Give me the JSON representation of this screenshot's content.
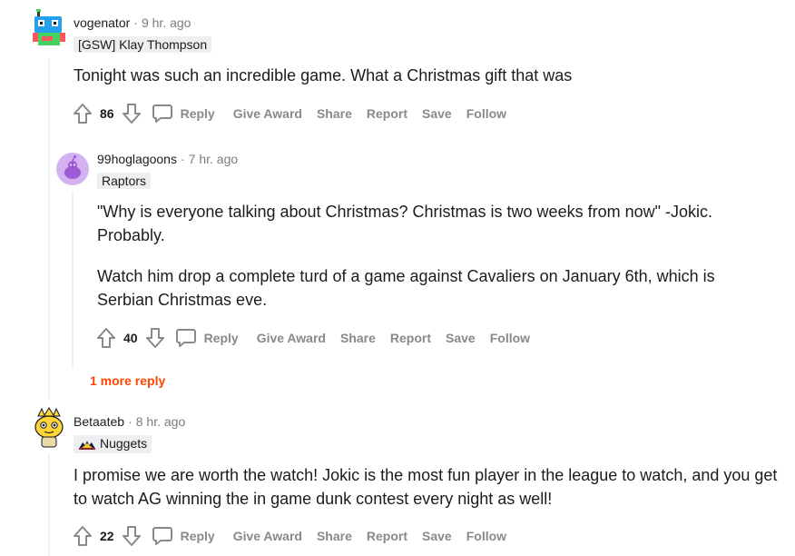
{
  "comments": [
    {
      "username": "vogenator",
      "time": "9 hr. ago",
      "flair": "[GSW] Klay Thompson",
      "body": [
        "Tonight was such an incredible game. What a Christmas gift that was"
      ],
      "score": "86"
    },
    {
      "username": "99hoglagoons",
      "time": "7 hr. ago",
      "flair": "Raptors",
      "body": [
        "\"Why is everyone talking about Christmas? Christmas is two weeks from now\" -Jokic. Probably.",
        "Watch him drop a complete turd of a game against Cavaliers on January 6th, which is Serbian Christmas eve."
      ],
      "score": "40"
    },
    {
      "username": "Betaateb",
      "time": "8 hr. ago",
      "flair": "Nuggets",
      "body": [
        "I promise we are worth the watch! Jokic is the most fun player in the league to watch, and you get to watch AG winning the in game dunk contest every night as well!"
      ],
      "score": "22"
    }
  ],
  "actions": {
    "reply": "Reply",
    "give_award": "Give Award",
    "share": "Share",
    "report": "Report",
    "save": "Save",
    "follow": "Follow"
  },
  "more_replies": "1 more reply",
  "separator": "·",
  "icons": {
    "upvote": "upvote-arrow-icon",
    "downvote": "downvote-arrow-icon",
    "reply": "speech-bubble-icon",
    "flair": "nuggets-flair-icon"
  },
  "colors": {
    "more_reply": "#ff4500",
    "action_text": "#878a8c",
    "thread_line": "#edeff1",
    "flair_bg": "#edeff1"
  }
}
